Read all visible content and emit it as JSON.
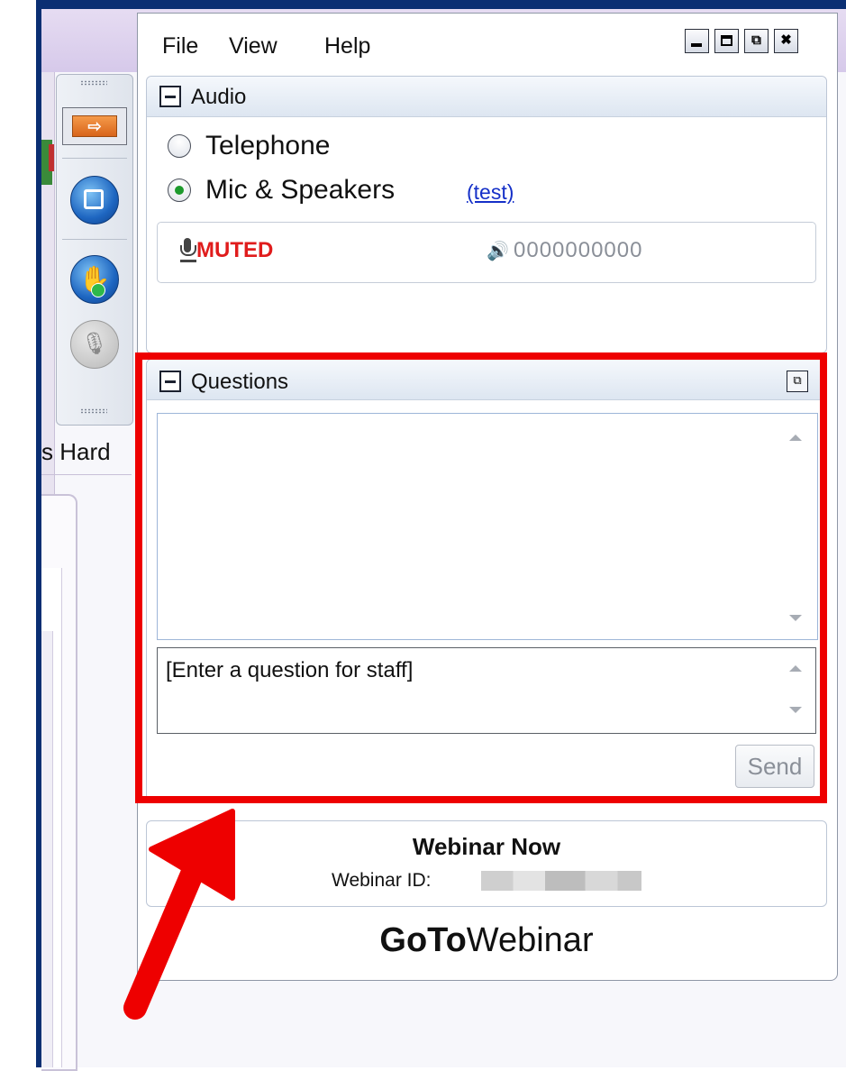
{
  "background_app": {
    "tab_label": "s Hard"
  },
  "menu": {
    "items": [
      "File",
      "View",
      "Help"
    ]
  },
  "window_controls": {
    "restore_glyph": "⧉",
    "close_glyph": "✖"
  },
  "audio": {
    "title": "Audio",
    "options": [
      {
        "label": "Telephone",
        "selected": false
      },
      {
        "label": "Mic & Speakers",
        "selected": true
      }
    ],
    "test_link": "(test)",
    "status": "MUTED",
    "level_meter": "0000000000",
    "status_color": "#e01c1c"
  },
  "questions": {
    "title": "Questions",
    "input_placeholder": "[Enter a question for staff]",
    "send_label": "Send"
  },
  "webinar": {
    "name": "Webinar Now",
    "id_label": "Webinar ID:"
  },
  "branding": {
    "logo_bold": "GoTo",
    "logo_regular": "Webinar"
  },
  "annotation": {
    "highlight_color": "#ee0000"
  }
}
